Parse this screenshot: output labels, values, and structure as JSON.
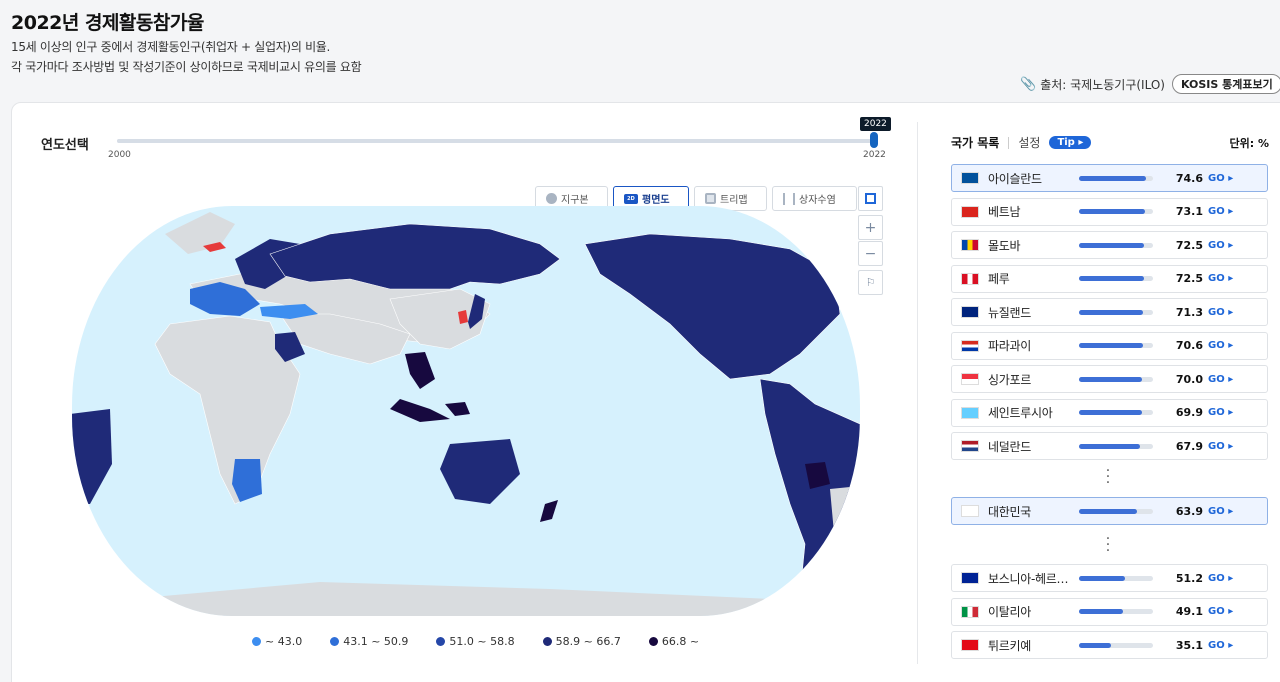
{
  "header": {
    "title": "2022년 경제활동참가율",
    "desc_line1": "15세 이상의 인구 중에서 경제활동인구(취업자 + 실업자)의 비율.",
    "desc_line2": "각 국가마다 조사방법 및 작성기준이 상이하므로 국제비교시 유의를 요함",
    "source": "출처: 국제노동기구(ILO)",
    "kosis_button": "KOSIS 통계표보기"
  },
  "year_slider": {
    "label": "연도선택",
    "min": "2000",
    "max": "2022",
    "current": "2022"
  },
  "view_tabs": [
    {
      "label": "지구본",
      "icon": "globe-icon",
      "active": false
    },
    {
      "label": "평면도",
      "icon": "flat-map-icon",
      "active": true
    },
    {
      "label": "트리맵",
      "icon": "treemap-icon",
      "active": false
    },
    {
      "label": "상자수염",
      "icon": "boxplot-icon",
      "active": false
    }
  ],
  "map_controls": {
    "zoom_in": "+",
    "zoom_out": "−"
  },
  "legend": [
    {
      "label": "~ 43.0",
      "color": "#3d8ef0"
    },
    {
      "label": "43.1 ~ 50.9",
      "color": "#2f6fd8"
    },
    {
      "label": "51.0 ~ 58.8",
      "color": "#2547a8"
    },
    {
      "label": "58.9 ~ 66.7",
      "color": "#1f2a78"
    },
    {
      "label": "66.8 ~",
      "color": "#17093f"
    }
  ],
  "country_list": {
    "title": "국가 목록",
    "settings": "설정",
    "tip": "Tip ▸",
    "unit": "단위: %",
    "go": "GO ▸",
    "top": [
      {
        "name": "아이슬란드",
        "value": "74.6",
        "flag": "iceland",
        "highlight": true
      },
      {
        "name": "베트남",
        "value": "73.1",
        "flag": "vietnam"
      },
      {
        "name": "몰도바",
        "value": "72.5",
        "flag": "moldova"
      },
      {
        "name": "페루",
        "value": "72.5",
        "flag": "peru"
      },
      {
        "name": "뉴질랜드",
        "value": "71.3",
        "flag": "newzealand"
      },
      {
        "name": "파라과이",
        "value": "70.6",
        "flag": "paraguay"
      },
      {
        "name": "싱가포르",
        "value": "70.0",
        "flag": "singapore"
      },
      {
        "name": "세인트루시아",
        "value": "69.9",
        "flag": "stlucia"
      },
      {
        "name": "네덜란드",
        "value": "67.9",
        "flag": "netherlands"
      }
    ],
    "korea": {
      "name": "대한민국",
      "value": "63.9",
      "flag": "korea"
    },
    "bottom": [
      {
        "name": "보스니아-헤르…",
        "value": "51.2",
        "flag": "bosnia"
      },
      {
        "name": "이탈리아",
        "value": "49.1",
        "flag": "italy"
      },
      {
        "name": "튀르키예",
        "value": "35.1",
        "flag": "turkey"
      }
    ]
  }
}
